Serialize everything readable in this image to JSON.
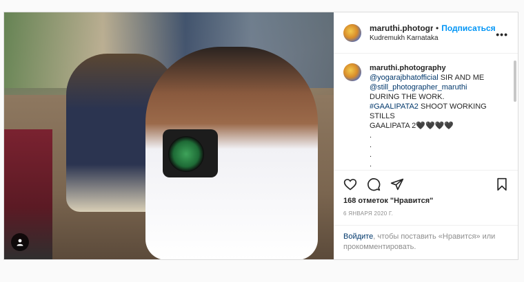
{
  "post": {
    "photo_alt": "Photographer holding a camera",
    "author": {
      "username": "maruthi.photograp",
      "follow_label": "Подписаться",
      "location": "Kudremukh Karnataka"
    },
    "caption": {
      "username": "maruthi.photography",
      "mention1": "@yogarajbhatofficial",
      "text1": " SIR AND ME",
      "mention2": "@still_photographer_maruthi",
      "line3": "DURING THE WORK.",
      "hashtag": "#GAALIPATA2",
      "text4": " SHOOT WORKING",
      "line5": "STILLS",
      "line6": "GAALIPATA 2🖤🖤🖤🖤",
      "dots": [
        ".",
        ".",
        ".",
        "."
      ]
    },
    "likes": "168 отметок \"Нравится\"",
    "date": "6 ЯНВАРЯ 2020 Г.",
    "login_link": "Войдите",
    "login_text": ", чтобы поставить «Нравится» или прокомментировать."
  },
  "colors": {
    "accent": "#0095f6",
    "link": "#00376b",
    "muted": "#8e8e8e"
  },
  "icons": [
    "more-icon",
    "heart-icon",
    "comment-icon",
    "share-icon",
    "bookmark-icon",
    "user-tag-icon"
  ]
}
